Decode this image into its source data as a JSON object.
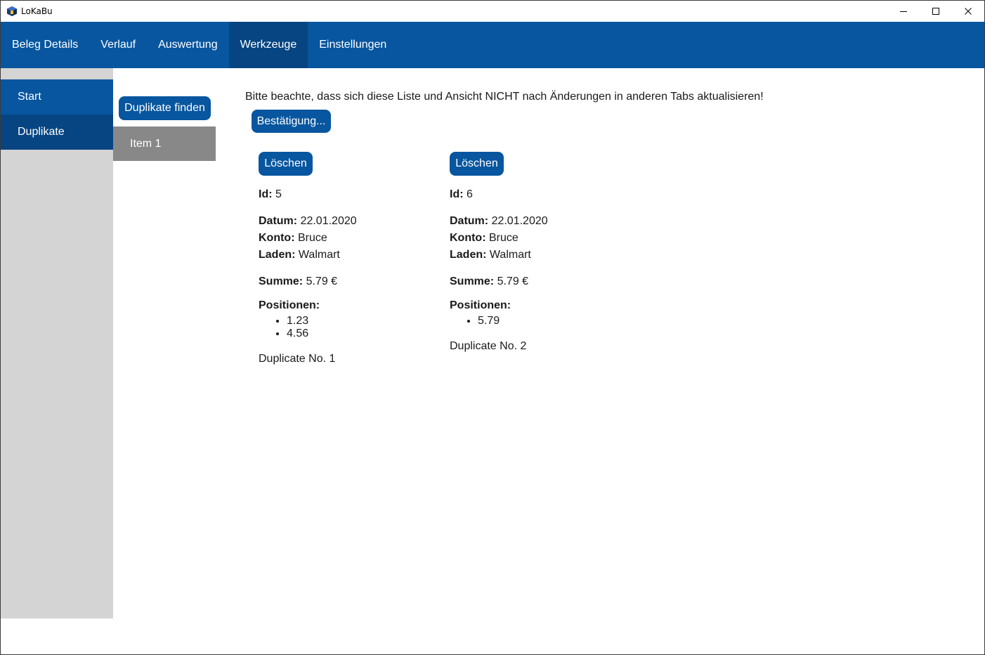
{
  "window": {
    "title": "LoKaBu",
    "controls": [
      "minimize-icon",
      "maximize-icon",
      "close-icon"
    ]
  },
  "colors": {
    "primary": "#07569f",
    "primary_dark": "#064582",
    "sidebar_bg": "#d4d4d4",
    "list_item_bg": "#888888"
  },
  "topnav": {
    "tabs": [
      {
        "label": "Beleg Details"
      },
      {
        "label": "Verlauf"
      },
      {
        "label": "Auswertung"
      },
      {
        "label": "Werkzeuge",
        "active": true
      },
      {
        "label": "Einstellungen"
      }
    ]
  },
  "sidebar": {
    "items": [
      {
        "label": "Start"
      },
      {
        "label": "Duplikate",
        "active": true
      }
    ]
  },
  "duplicates_panel": {
    "find_button": "Duplikate finden",
    "items": [
      {
        "label": "Item 1"
      }
    ]
  },
  "main": {
    "notice": "Bitte beachte, dass sich diese Liste und Ansicht NICHT nach Änderungen in anderen Tabs aktualisieren!",
    "confirm_button": "Bestätigung...",
    "labels": {
      "id": "Id:",
      "date": "Datum:",
      "account": "Konto:",
      "store": "Laden:",
      "sum": "Summe:",
      "positions": "Positionen:"
    },
    "duplicates": [
      {
        "delete_button": "Löschen",
        "id": "5",
        "date": "22.01.2020",
        "account": "Bruce",
        "store": "Walmart",
        "sum": "5.79 €",
        "positions": [
          "1.23",
          "4.56"
        ],
        "footer": "Duplicate No. 1"
      },
      {
        "delete_button": "Löschen",
        "id": "6",
        "date": "22.01.2020",
        "account": "Bruce",
        "store": "Walmart",
        "sum": "5.79 €",
        "positions": [
          "5.79"
        ],
        "footer": "Duplicate No. 2"
      }
    ]
  }
}
